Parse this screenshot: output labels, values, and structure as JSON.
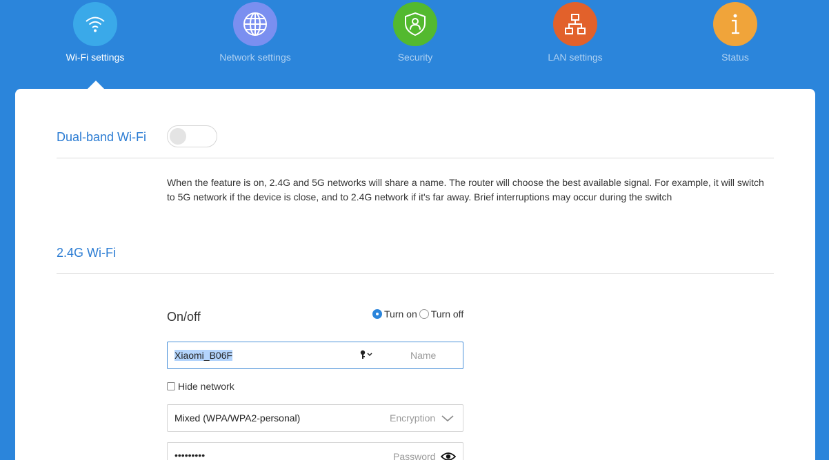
{
  "nav": [
    {
      "label": "Wi-Fi settings",
      "icon": "wifi-icon",
      "color": "#3aa9e9",
      "active": true
    },
    {
      "label": "Network settings",
      "icon": "globe-icon",
      "color": "#7a8ff0",
      "active": false
    },
    {
      "label": "Security",
      "icon": "shield-user-icon",
      "color": "#53b92f",
      "active": false
    },
    {
      "label": "LAN settings",
      "icon": "network-tree-icon",
      "color": "#e2612b",
      "active": false
    },
    {
      "label": "Status",
      "icon": "info-icon",
      "color": "#f0a43a",
      "active": false
    }
  ],
  "dual_band": {
    "title": "Dual-band Wi-Fi",
    "enabled": false,
    "description": "When the feature is on, 2.4G and 5G networks will share a name. The router will choose the best available signal. For example, it will switch to 5G network if the device is close, and to 2.4G network if it's far away. Brief interruptions may occur during the switch"
  },
  "wifi24": {
    "title": "2.4G Wi-Fi",
    "onoff_label": "On/off",
    "turn_on_label": "Turn on",
    "turn_off_label": "Turn off",
    "selected": "on",
    "name_value": "Xiaomi_B06F",
    "name_hint": "Name",
    "hide_network_label": "Hide network",
    "hide_network_checked": false,
    "encryption_value": "Mixed (WPA/WPA2-personal)",
    "encryption_hint": "Encryption",
    "password_value": "•••••••••",
    "password_hint": "Password"
  },
  "colors": {
    "background": "#2b85db",
    "title_blue": "#2b7cd3",
    "radio_active": "#2b85db"
  }
}
